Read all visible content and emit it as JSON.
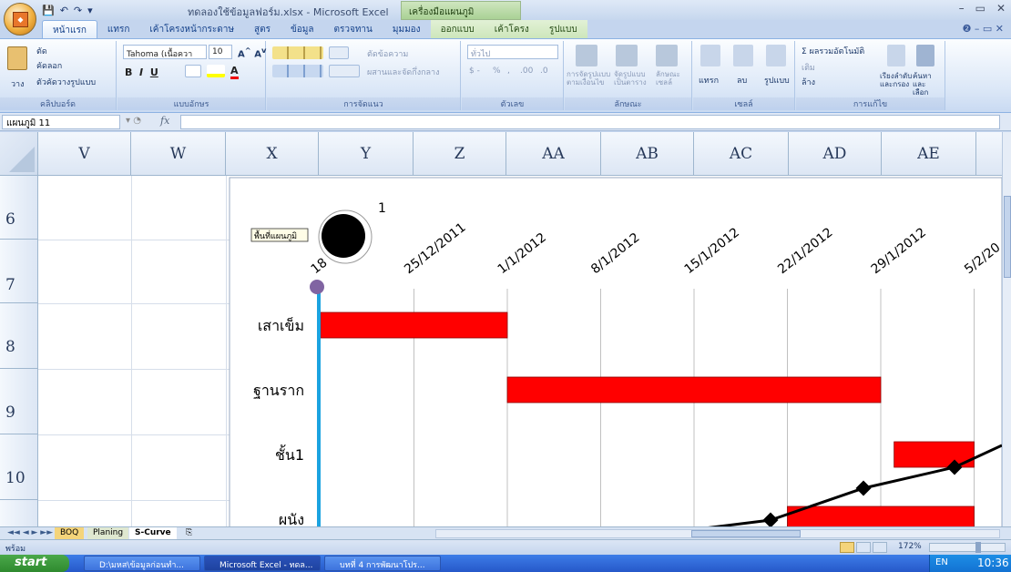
{
  "window": {
    "title": "ทดลองใช้ข้อมูลฟอร์ม.xlsx - Microsoft Excel",
    "context_tab_group": "เครื่องมือแผนภูมิ",
    "controls": [
      "–",
      "▭",
      "✕"
    ]
  },
  "tabs": [
    {
      "label": "หน้าแรก",
      "active": true
    },
    {
      "label": "แทรก"
    },
    {
      "label": "เค้าโครงหน้ากระดาษ"
    },
    {
      "label": "สูตร"
    },
    {
      "label": "ข้อมูล"
    },
    {
      "label": "ตรวจทาน"
    },
    {
      "label": "มุมมอง"
    },
    {
      "label": "ออกแบบ",
      "context": true
    },
    {
      "label": "เค้าโครง",
      "context": true
    },
    {
      "label": "รูปแบบ",
      "context": true
    }
  ],
  "ribbon": {
    "clipboard": {
      "paste": "วาง",
      "cut": "ตัด",
      "copy": "คัดลอก",
      "format_painter": "ตัวคัดวางรูปแบบ",
      "label": "คลิปบอร์ด"
    },
    "font": {
      "name": "Tahoma (เนื้อควา",
      "size": "10",
      "label": "แบบอักษร"
    },
    "alignment": {
      "wrap": "ตัดข้อความ",
      "merge": "ผสานและจัดกึ่งกลาง",
      "label": "การจัดแนว"
    },
    "number": {
      "format": "ทั่วไป",
      "percent": "%",
      "comma": ",",
      "inc_decimal": ".00",
      "dec_decimal": ".0",
      "label": "ตัวเลข"
    },
    "styles": {
      "conditional": "การจัดรูปแบบ ตามเงื่อนไข",
      "table": "จัดรูปแบบ เป็นตาราง",
      "cell": "ลักษณะ เซลล์",
      "label": "ลักษณะ"
    },
    "cells": {
      "insert": "แทรก",
      "delete": "ลบ",
      "format": "รูปแบบ",
      "label": "เซลล์"
    },
    "editing": {
      "autosum": "ผลรวมอัตโนมัติ",
      "fill": "เติม",
      "clear": "ล้าง",
      "sort": "เรียงลำดับ และกรอง",
      "find": "ค้นหาและ เลือก",
      "label": "การแก้ไข"
    }
  },
  "formula_bar": {
    "name_box": "แผนภูมิ 11",
    "fx": "fx",
    "content": ""
  },
  "columns": [
    "V",
    "W",
    "X",
    "Y",
    "Z",
    "AA",
    "AB",
    "AC",
    "AD",
    "AE"
  ],
  "rows": [
    "6",
    "7",
    "8",
    "9",
    "10"
  ],
  "chart": {
    "chart_area_label": "พื้นที่แผนภูมิ",
    "date_labels": [
      "18",
      "25/12/2011",
      "1/1/2012",
      "8/1/2012",
      "15/1/2012",
      "22/1/2012",
      "29/1/2012",
      "5/2/20"
    ],
    "marker_label_fragment": "1",
    "task_labels": [
      "เสาเข็ม",
      "ฐานราก",
      "ชั้น1",
      "ผนัง"
    ],
    "colors": {
      "bar": "#ff0000",
      "axis": "#1ba3e0",
      "curve": "#000000",
      "marker_top": "#8064a2"
    }
  },
  "chart_data": {
    "type": "bar",
    "categories": [
      "เสาเข็ม",
      "ฐานราก",
      "ชั้น1",
      "ผนัง"
    ],
    "x_ticks": [
      "18",
      "25/12/2011",
      "1/1/2012",
      "8/1/2012",
      "15/1/2012",
      "22/1/2012",
      "29/1/2012",
      "5/2/20"
    ],
    "bars": [
      {
        "task": "เสาเข็ม",
        "start": "18/12/2011",
        "end": "1/1/2012"
      },
      {
        "task": "ฐานราก",
        "start": "1/1/2012",
        "end": "29/1/2012"
      },
      {
        "task": "ชั้น1",
        "start": "30/1/2012",
        "end": "5/2/2012"
      },
      {
        "task": "ผนัง",
        "start": "22/1/2012",
        "end": "5/2/2012"
      }
    ],
    "gantt": true,
    "grid": true
  },
  "sheet_tabs": [
    {
      "label": "BOQ"
    },
    {
      "label": "Planing"
    },
    {
      "label": "S-Curve",
      "active": true
    }
  ],
  "status": {
    "ready": "พร้อม",
    "zoom": "172%"
  },
  "taskbar": {
    "start": "start",
    "items": [
      "D:\\มหส\\ข้อมูลก่อนทำ...",
      "Microsoft Excel - ทดล...",
      "บทที่ 4 การพัฒนาโปร..."
    ],
    "lang": "EN",
    "clock": "10:36"
  }
}
